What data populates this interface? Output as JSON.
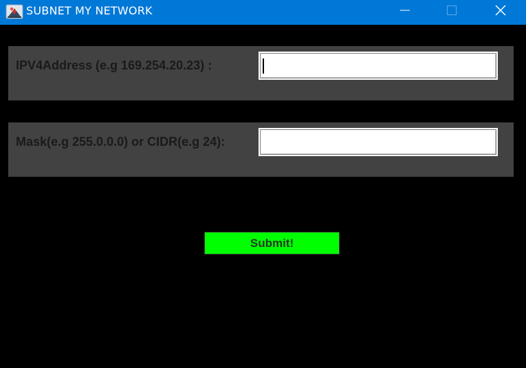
{
  "window": {
    "title": "SUBNET MY NETWORK",
    "titlebar_color": "#0078d7",
    "icon": "java-app-icon",
    "controls": {
      "minimize_icon": "minimize-icon",
      "maximize_icon": "maximize-icon",
      "close_icon": "close-icon"
    }
  },
  "form": {
    "panel_color": "#424242",
    "background_color": "#000000",
    "ipv4": {
      "label": "IPV4Address (e.g 169.254.20.23) :",
      "value": ""
    },
    "mask": {
      "label": "Mask(e.g 255.0.0.0) or CIDR(e.g 24):",
      "value": ""
    },
    "submit": {
      "label": "Submit!",
      "color": "#00ff00"
    }
  }
}
